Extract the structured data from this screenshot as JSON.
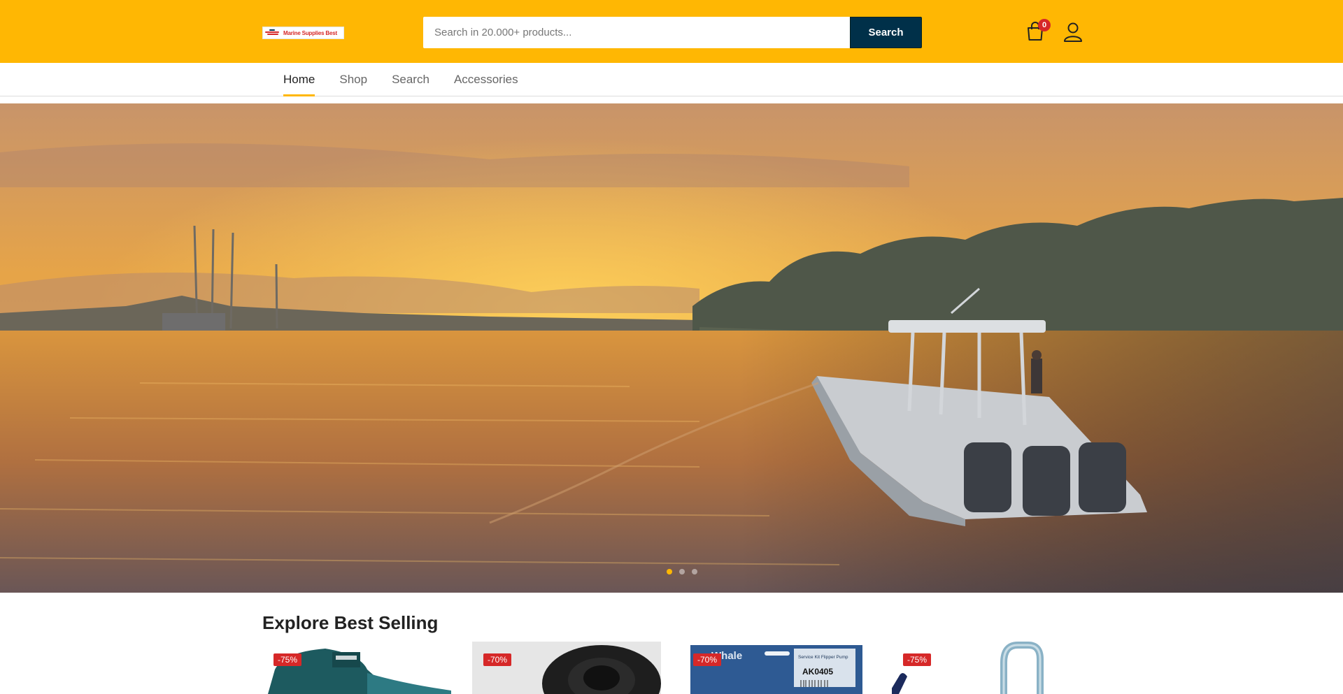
{
  "header": {
    "logo_text": "Marine Supplies Best",
    "search_placeholder": "Search in 20.000+ products...",
    "search_button_label": "Search",
    "cart_count": "0",
    "cart_icon": "shopping-bag-icon",
    "account_icon": "user-icon"
  },
  "nav": {
    "items": [
      {
        "label": "Home",
        "active": true
      },
      {
        "label": "Shop",
        "active": false
      },
      {
        "label": "Search",
        "active": false
      },
      {
        "label": "Accessories",
        "active": false
      }
    ]
  },
  "hero": {
    "slide_count": 3,
    "active_slide": 1
  },
  "best_selling": {
    "title": "Explore Best Selling",
    "products": [
      {
        "discount": "-75%"
      },
      {
        "discount": "-70%"
      },
      {
        "discount": "-70%",
        "brand_text": "Whale",
        "package_text": "Service Kit Flipper Pump",
        "code": "AK0405"
      },
      {
        "discount": "-75%"
      }
    ]
  },
  "colors": {
    "brand_yellow": "#ffb703",
    "search_button": "#003049",
    "badge_red": "#d62828"
  }
}
